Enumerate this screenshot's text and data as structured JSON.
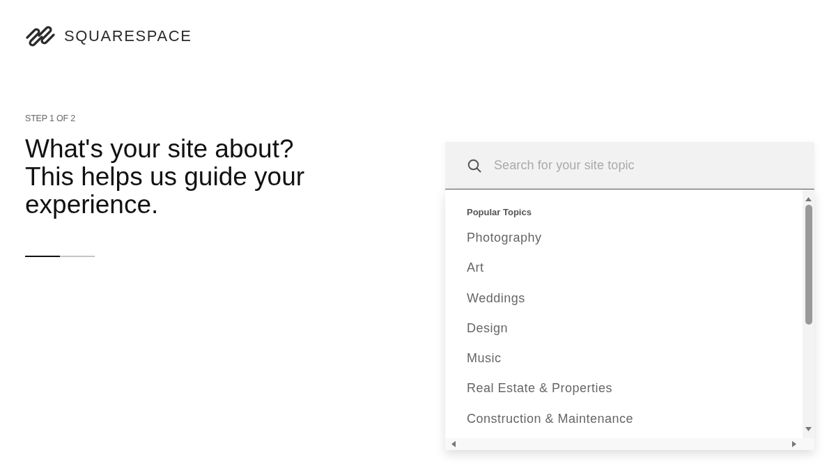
{
  "brand": {
    "name": "SQUARESPACE"
  },
  "step": {
    "label": "STEP 1 OF 2",
    "progress": {
      "level": 0.5
    }
  },
  "heading": "What's your site about? This helps us guide your experience.",
  "search": {
    "placeholder": "Search for your site topic"
  },
  "topics": {
    "heading": "Popular Topics",
    "items": [
      {
        "label": "Photography"
      },
      {
        "label": "Art"
      },
      {
        "label": "Weddings"
      },
      {
        "label": "Design"
      },
      {
        "label": "Music"
      },
      {
        "label": "Real Estate & Properties"
      },
      {
        "label": "Construction & Maintenance"
      }
    ]
  }
}
